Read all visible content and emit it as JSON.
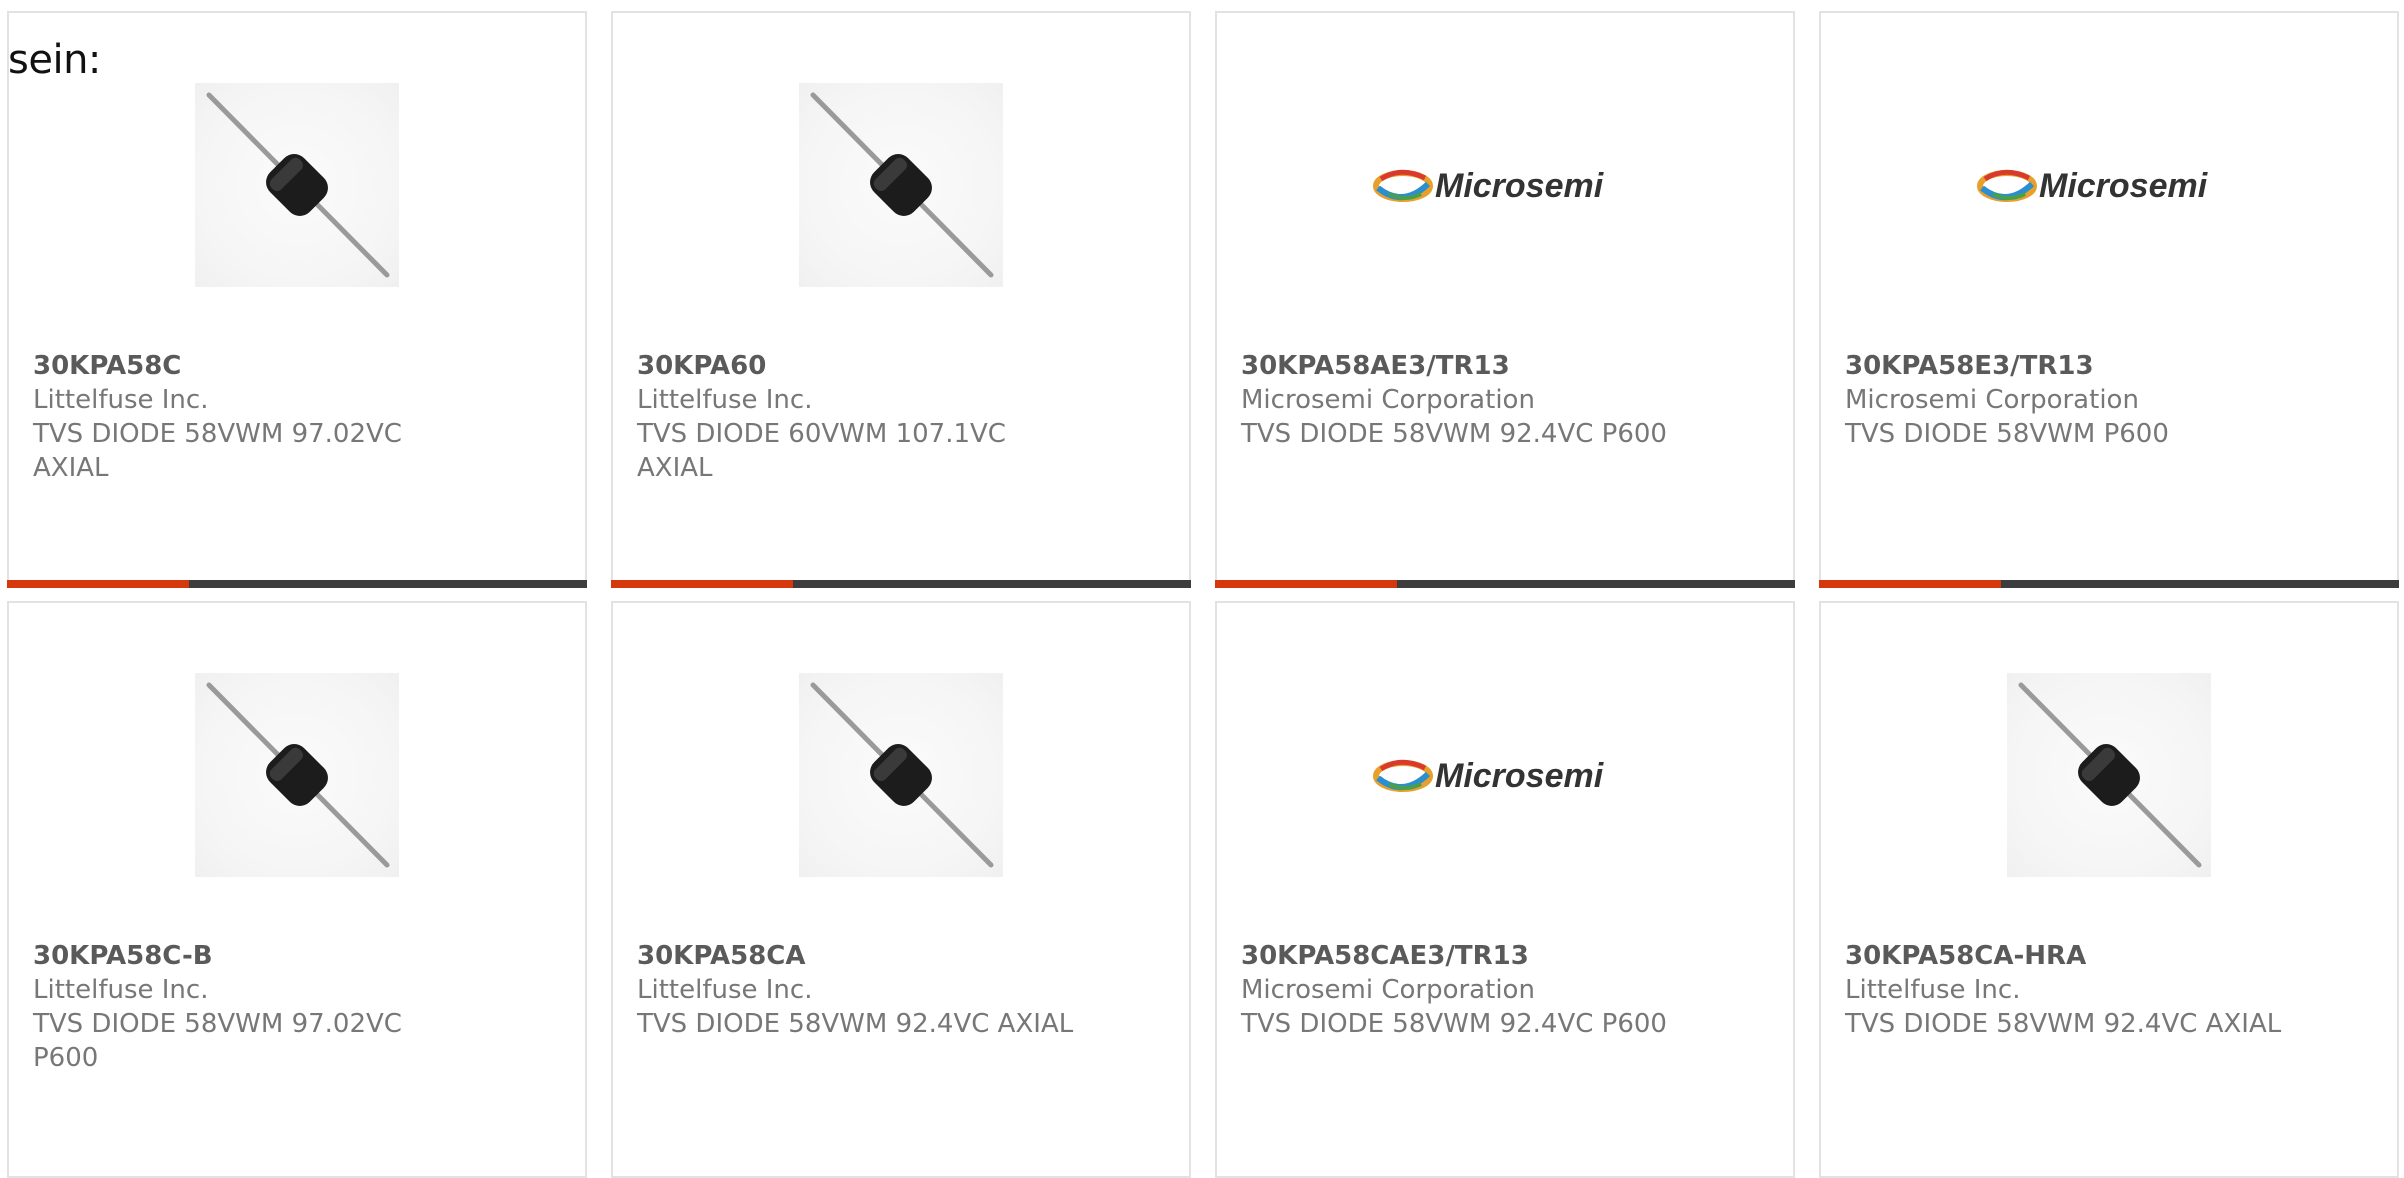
{
  "intro_text": "sein:",
  "colors": {
    "accent": "#d6380d",
    "bar": "#3d3d3d",
    "border": "#e2e2e2",
    "part": "#5a5a5a",
    "text": "#777777"
  },
  "products": [
    {
      "part": "30KPA58C",
      "manufacturer": "Littelfuse Inc.",
      "description": "TVS DIODE 58VWM 97.02VC AXIAL",
      "image": "axial-diode"
    },
    {
      "part": "30KPA60",
      "manufacturer": "Littelfuse Inc.",
      "description": "TVS DIODE 60VWM 107.1VC AXIAL",
      "image": "axial-diode"
    },
    {
      "part": "30KPA58AE3/TR13",
      "manufacturer": "Microsemi Corporation",
      "description": "TVS DIODE 58VWM 92.4VC P600",
      "image": "microsemi-logo",
      "logo_text": "Microsemi"
    },
    {
      "part": "30KPA58E3/TR13",
      "manufacturer": "Microsemi Corporation",
      "description": "TVS DIODE 58VWM P600",
      "image": "microsemi-logo",
      "logo_text": "Microsemi"
    },
    {
      "part": "30KPA58C-B",
      "manufacturer": "Littelfuse Inc.",
      "description": "TVS DIODE 58VWM 97.02VC P600",
      "image": "axial-diode"
    },
    {
      "part": "30KPA58CA",
      "manufacturer": "Littelfuse Inc.",
      "description": "TVS DIODE 58VWM 92.4VC AXIAL",
      "image": "axial-diode"
    },
    {
      "part": "30KPA58CAE3/TR13",
      "manufacturer": "Microsemi Corporation",
      "description": "TVS DIODE 58VWM 92.4VC P600",
      "image": "microsemi-logo",
      "logo_text": "Microsemi"
    },
    {
      "part": "30KPA58CA-HRA",
      "manufacturer": "Littelfuse Inc.",
      "description": "TVS DIODE 58VWM 92.4VC AXIAL",
      "image": "axial-diode"
    }
  ]
}
